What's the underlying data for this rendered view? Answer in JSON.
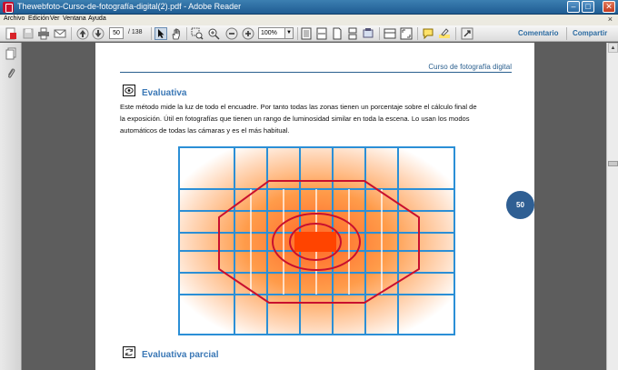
{
  "window": {
    "title": "Thewebfoto-Curso-de-fotografía-digital(2).pdf - Adobe Reader",
    "minimize": "–",
    "maximize": "□",
    "close": "✕"
  },
  "menu": {
    "items": [
      "Archivo",
      "Edición",
      "Ver",
      "Ventana",
      "Ayuda"
    ],
    "close_doc": "×"
  },
  "toolbar": {
    "current_page": "50",
    "total_pages": "/ 138",
    "zoom": "100%",
    "zoom_dropdown": "▼",
    "comment_label": "Comentario",
    "share_label": "Compartir"
  },
  "document": {
    "header": "Curso de fotografía digital",
    "section1_title": "Evaluativa",
    "section1_line1": "Este método mide la luz de todo el encuadre. Por tanto todas las zonas tienen un porcentaje sobre el cálculo final de",
    "section1_line2": "la exposición. Útil en fotografías que tienen un rango de luminosidad similar en toda la escena. Lo usan los modos",
    "section1_line3": "automáticos de todas las cámaras y es el más habitual.",
    "section2_title": "Evaluativa parcial",
    "page_badge": "50"
  },
  "scrollbar": {
    "up_arrow": "▲"
  },
  "colors": {
    "accent_blue": "#3b78b6",
    "grid_blue": "#2b8fd6",
    "ring_red": "#c8102e",
    "metering_orange": "#ff5a00"
  }
}
